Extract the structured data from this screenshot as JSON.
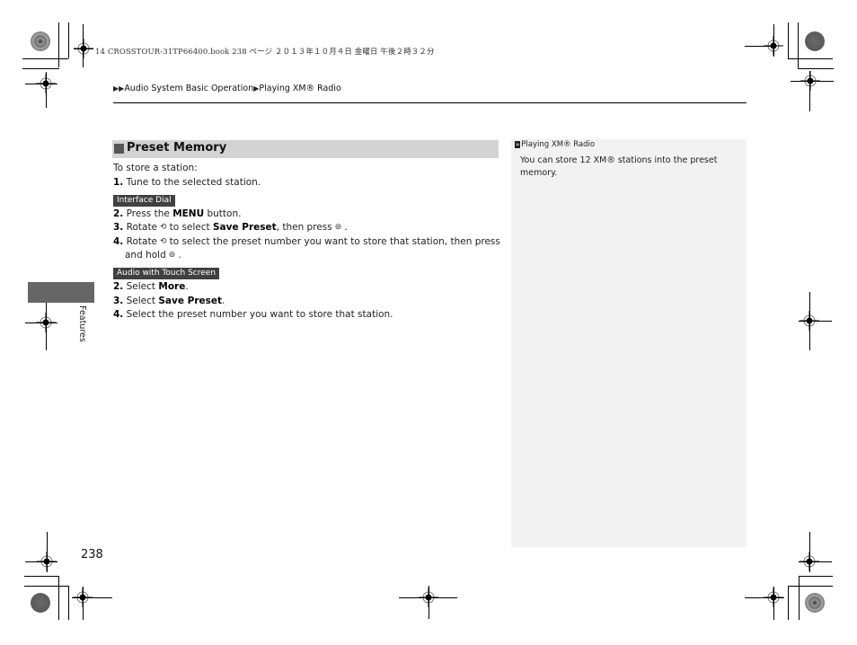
{
  "print_header": "14 CROSSTOUR-31TP66400.book  238 ページ  ２０１３年１０月４日  金曜日  午後２時３２分",
  "breadcrumb": {
    "prefix_icon": "double-triangle-right-icon",
    "items": [
      "Audio System Basic Operation",
      "Playing XM® Radio"
    ],
    "separator_icon": "triangle-right-icon"
  },
  "section": {
    "icon": "square-bullet-icon",
    "title": "Preset Memory"
  },
  "intro": "To store a station:",
  "step1": {
    "num": "1.",
    "text": "Tune to the selected station."
  },
  "interface_dial": {
    "tag": "Interface Dial",
    "steps": [
      {
        "num": "2.",
        "pre": "Press the ",
        "bold": "MENU",
        "post": " button."
      },
      {
        "num": "3.",
        "pre": "Rotate",
        "icon1": "rotate-dial-icon",
        "mid": "to select ",
        "bold": "Save Preset",
        "post": ", then press",
        "icon2": "press-dial-icon",
        "end": "."
      },
      {
        "num": "4.",
        "pre": "Rotate",
        "icon1": "rotate-dial-icon",
        "mid": "to select the preset number you want to store that station, then press",
        "line2": "and hold",
        "icon2": "press-dial-icon",
        "end": "."
      }
    ]
  },
  "touch_screen": {
    "tag": "Audio with Touch Screen",
    "steps": [
      {
        "num": "2.",
        "pre": "Select ",
        "bold": "More",
        "post": "."
      },
      {
        "num": "3.",
        "pre": "Select ",
        "bold": "Save Preset",
        "post": "."
      },
      {
        "num": "4.",
        "pre": "Select the preset number you want to store that station."
      }
    ]
  },
  "note": {
    "icon": "reference-arrow-icon",
    "heading": "Playing XM® Radio",
    "body": "You can store 12 XM® stations into the preset memory."
  },
  "side_tab": {
    "label": "Features"
  },
  "page_number": "238",
  "glyphs": {
    "double_tri": "▶▶",
    "tri": "▶",
    "ref": "»",
    "rotate": "⟲",
    "press": "⊚"
  }
}
